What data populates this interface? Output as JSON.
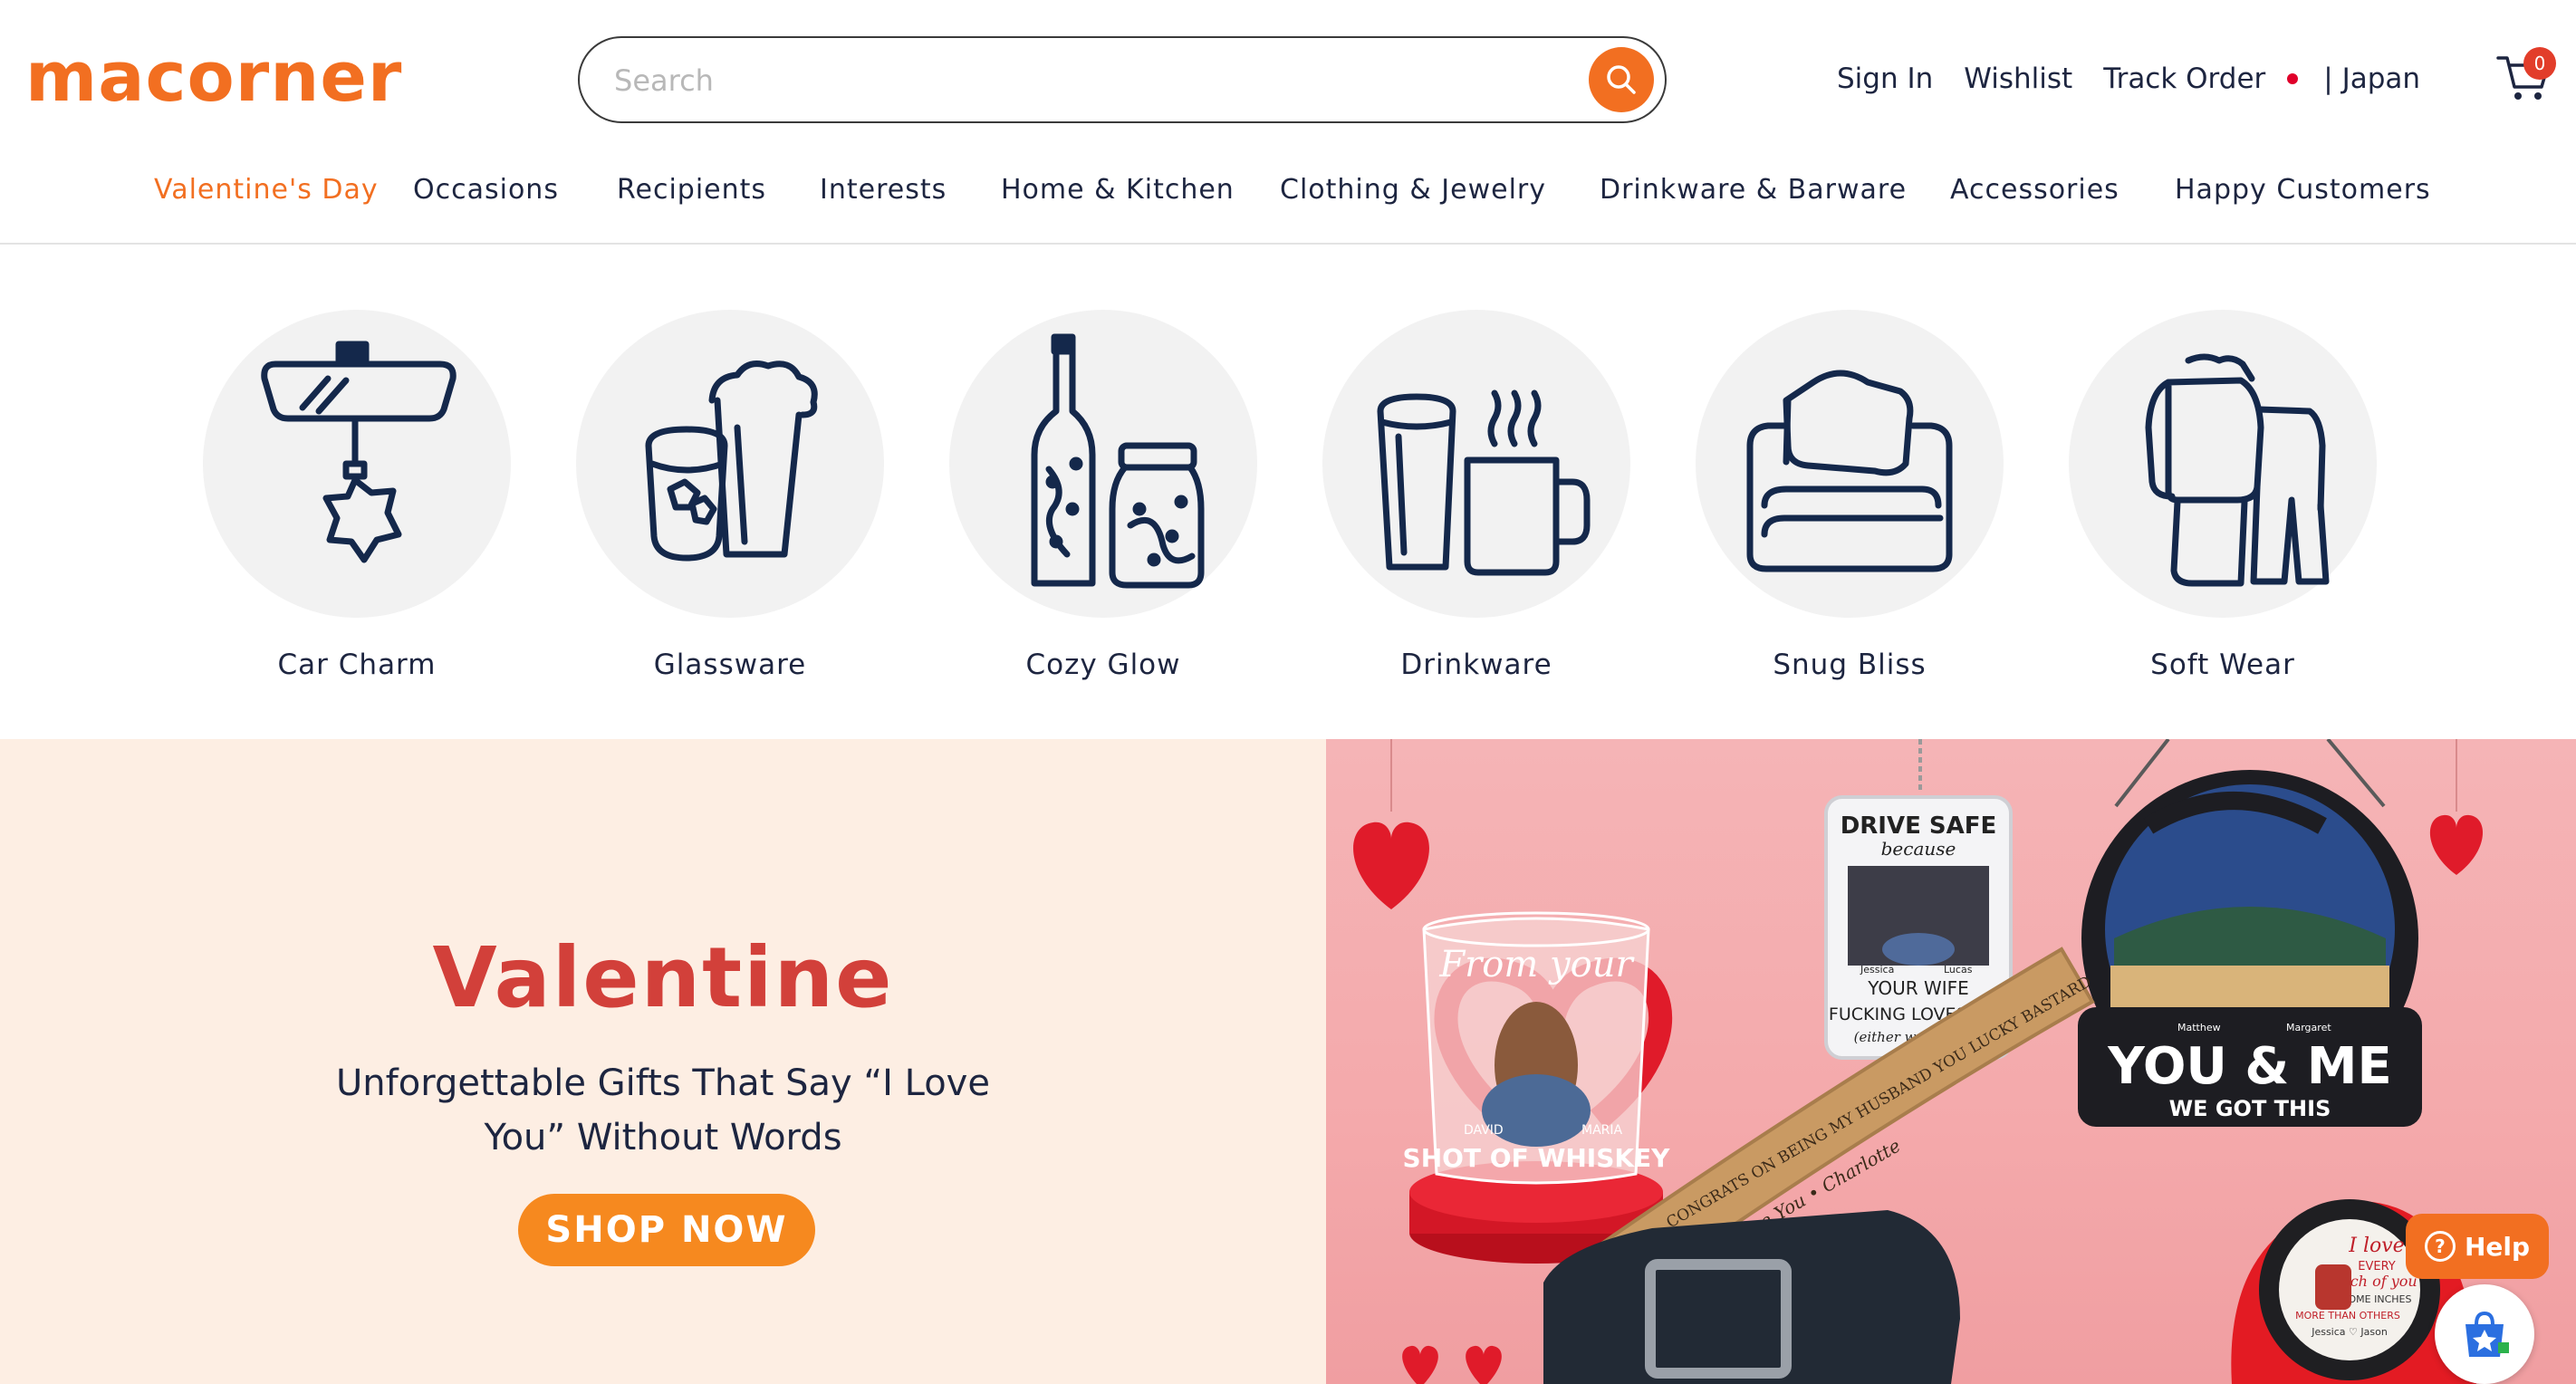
{
  "header": {
    "logo_text": "macorner",
    "brand_color": "#f26f21",
    "search": {
      "placeholder": "Search",
      "value": ""
    },
    "links": {
      "sign_in": "Sign In",
      "wishlist": "Wishlist",
      "track_order": "Track Order",
      "country": "| Japan"
    },
    "cart_count": "0"
  },
  "nav": {
    "items": [
      {
        "label": "Valentine's Day",
        "active": true
      },
      {
        "label": "Occasions"
      },
      {
        "label": "Recipients"
      },
      {
        "label": "Interests"
      },
      {
        "label": "Home & Kitchen"
      },
      {
        "label": "Clothing & Jewelry"
      },
      {
        "label": "Drinkware & Barware"
      },
      {
        "label": "Accessories"
      },
      {
        "label": "Happy Customers"
      }
    ]
  },
  "categories": [
    {
      "label": "Car Charm",
      "icon": "car-charm-icon"
    },
    {
      "label": "Glassware",
      "icon": "glassware-icon"
    },
    {
      "label": "Cozy Glow",
      "icon": "cozy-glow-icon"
    },
    {
      "label": "Drinkware",
      "icon": "drinkware-icon"
    },
    {
      "label": "Snug Bliss",
      "icon": "snug-bliss-icon"
    },
    {
      "label": "Soft Wear",
      "icon": "soft-wear-icon"
    }
  ],
  "hero": {
    "title": "Valentine",
    "subtitle": "Unforgettable Gifts That Say “I Love You” Without Words",
    "cta": "SHOP NOW",
    "products": {
      "whiskey_glass": {
        "line1": "From your",
        "names": [
          "DAVID",
          "MARIA"
        ],
        "caption": "SHOT OF WHISKEY"
      },
      "keychain": {
        "line1": "DRIVE SAFE",
        "line2": "because",
        "names": [
          "Jessica",
          "Lucas"
        ],
        "line3": "YOUR WIFE",
        "line4": "FUCKING LOVES YOU",
        "line5": "(either way works)"
      },
      "suncatcher": {
        "names": [
          "Matthew",
          "Margaret"
        ],
        "headline": "YOU & ME",
        "tagline": "WE GOT THIS"
      },
      "belt": {
        "text": "CONGRATS ON BEING MY HUSBAND YOU LUCKY BASTARD",
        "sign": "I Love You • Charlotte"
      },
      "tape": {
        "line1": "I love",
        "line2": "EVERY",
        "line3": "inch of you",
        "line4": "SOME INCHES",
        "line5": "MORE THAN OTHERS",
        "names": "Jessica ♡ Jason"
      }
    }
  },
  "widgets": {
    "help": "Help"
  }
}
